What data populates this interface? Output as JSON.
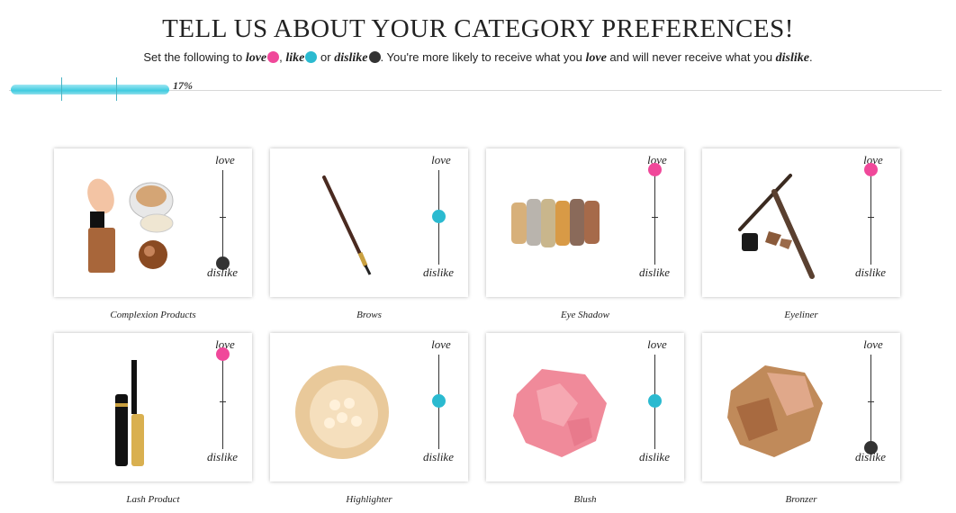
{
  "header": {
    "title": "TELL US ABOUT YOUR CATEGORY PREFERENCES!",
    "sub_prefix": "Set the following to ",
    "love_word": "love",
    "comma": ",",
    "like_word": "like",
    "or_text": " or ",
    "dislike_word": "dislike",
    "sub_middle": ". You're more likely to receive what you ",
    "love_word2": "love",
    "sub_end": " and will never receive what you ",
    "dislike_word2": "dislike",
    "period": "."
  },
  "progress": {
    "label": "17%",
    "fraction": 0.17
  },
  "colors": {
    "love": "#f0489a",
    "like": "#2bbad0",
    "dislike": "#333333",
    "progress": "#3fcbe0"
  },
  "slider_labels": {
    "top": "love",
    "bottom": "dislike"
  },
  "categories": [
    {
      "name": "Complexion Products",
      "value": "dislike",
      "icon": "complexion-products-image"
    },
    {
      "name": "Brows",
      "value": "like",
      "icon": "brow-pencil-image"
    },
    {
      "name": "Eye Shadow",
      "value": "love",
      "icon": "eye-shadow-swatches-image"
    },
    {
      "name": "Eyeliner",
      "value": "love",
      "icon": "eyeliner-pencils-image"
    },
    {
      "name": "Lash Product",
      "value": "love",
      "icon": "mascara-image"
    },
    {
      "name": "Highlighter",
      "value": "like",
      "icon": "highlighter-powder-image"
    },
    {
      "name": "Blush",
      "value": "like",
      "icon": "blush-powder-image"
    },
    {
      "name": "Bronzer",
      "value": "dislike",
      "icon": "bronzer-powder-image"
    }
  ]
}
